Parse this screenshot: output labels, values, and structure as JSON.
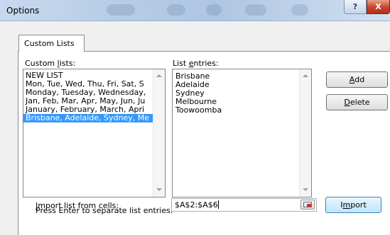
{
  "window": {
    "title": "Options",
    "help_glyph": "?",
    "close_glyph": "X"
  },
  "tab": {
    "label": "Custom Lists"
  },
  "custom_lists": {
    "label_pre": "Custom ",
    "label_ul": "l",
    "label_post": "ists:",
    "items": [
      {
        "label": "NEW LIST"
      },
      {
        "label": "Mon, Tue, Wed, Thu, Fri, Sat, S"
      },
      {
        "label": "Monday, Tuesday, Wednesday,"
      },
      {
        "label": "Jan, Feb, Mar, Apr, May, Jun, Ju"
      },
      {
        "label": "January, February, March, Apri"
      },
      {
        "label": "Brisbane, Adelaide, Sydney, Me"
      }
    ],
    "selected_index": 5
  },
  "list_entries": {
    "label_pre": "List ",
    "label_ul": "e",
    "label_post": "ntries:",
    "lines": [
      "Brisbane",
      "Adelaide",
      "Sydney",
      "Melbourne",
      "Toowoomba"
    ]
  },
  "buttons": {
    "add": {
      "ul": "A",
      "rest": "dd"
    },
    "delete": {
      "ul": "D",
      "rest": "elete"
    },
    "import": {
      "pre": "I",
      "ul": "m",
      "rest": "port"
    }
  },
  "hint": "Press Enter to separate list entries.",
  "import_field": {
    "label_ul": "I",
    "label_rest": "mport list from cells:",
    "value": "$A$2:$A$6"
  },
  "colors": {
    "selection": "#3399ff",
    "titlebar": "#b7cde6",
    "close": "#c9422a"
  }
}
